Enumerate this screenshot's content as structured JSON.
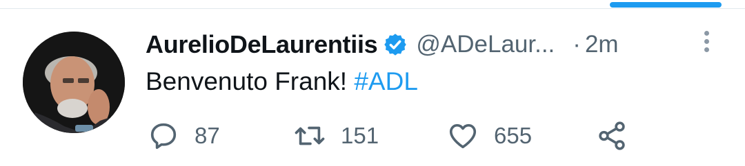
{
  "tweet": {
    "author": {
      "display_name": "AurelioDeLaurentiis",
      "handle": "@ADeLaur...",
      "verified": true
    },
    "separator": "·",
    "timestamp": "2m",
    "text": "Benvenuto Frank! ",
    "hashtag": "#ADL",
    "actions": {
      "reply_count": "87",
      "retweet_count": "151",
      "like_count": "655"
    }
  },
  "colors": {
    "accent": "#1d9bf0",
    "text_primary": "#0f1419",
    "text_secondary": "#536471"
  },
  "icons": [
    "verified-badge-icon",
    "more-options-icon",
    "reply-icon",
    "retweet-icon",
    "like-icon",
    "share-icon"
  ]
}
